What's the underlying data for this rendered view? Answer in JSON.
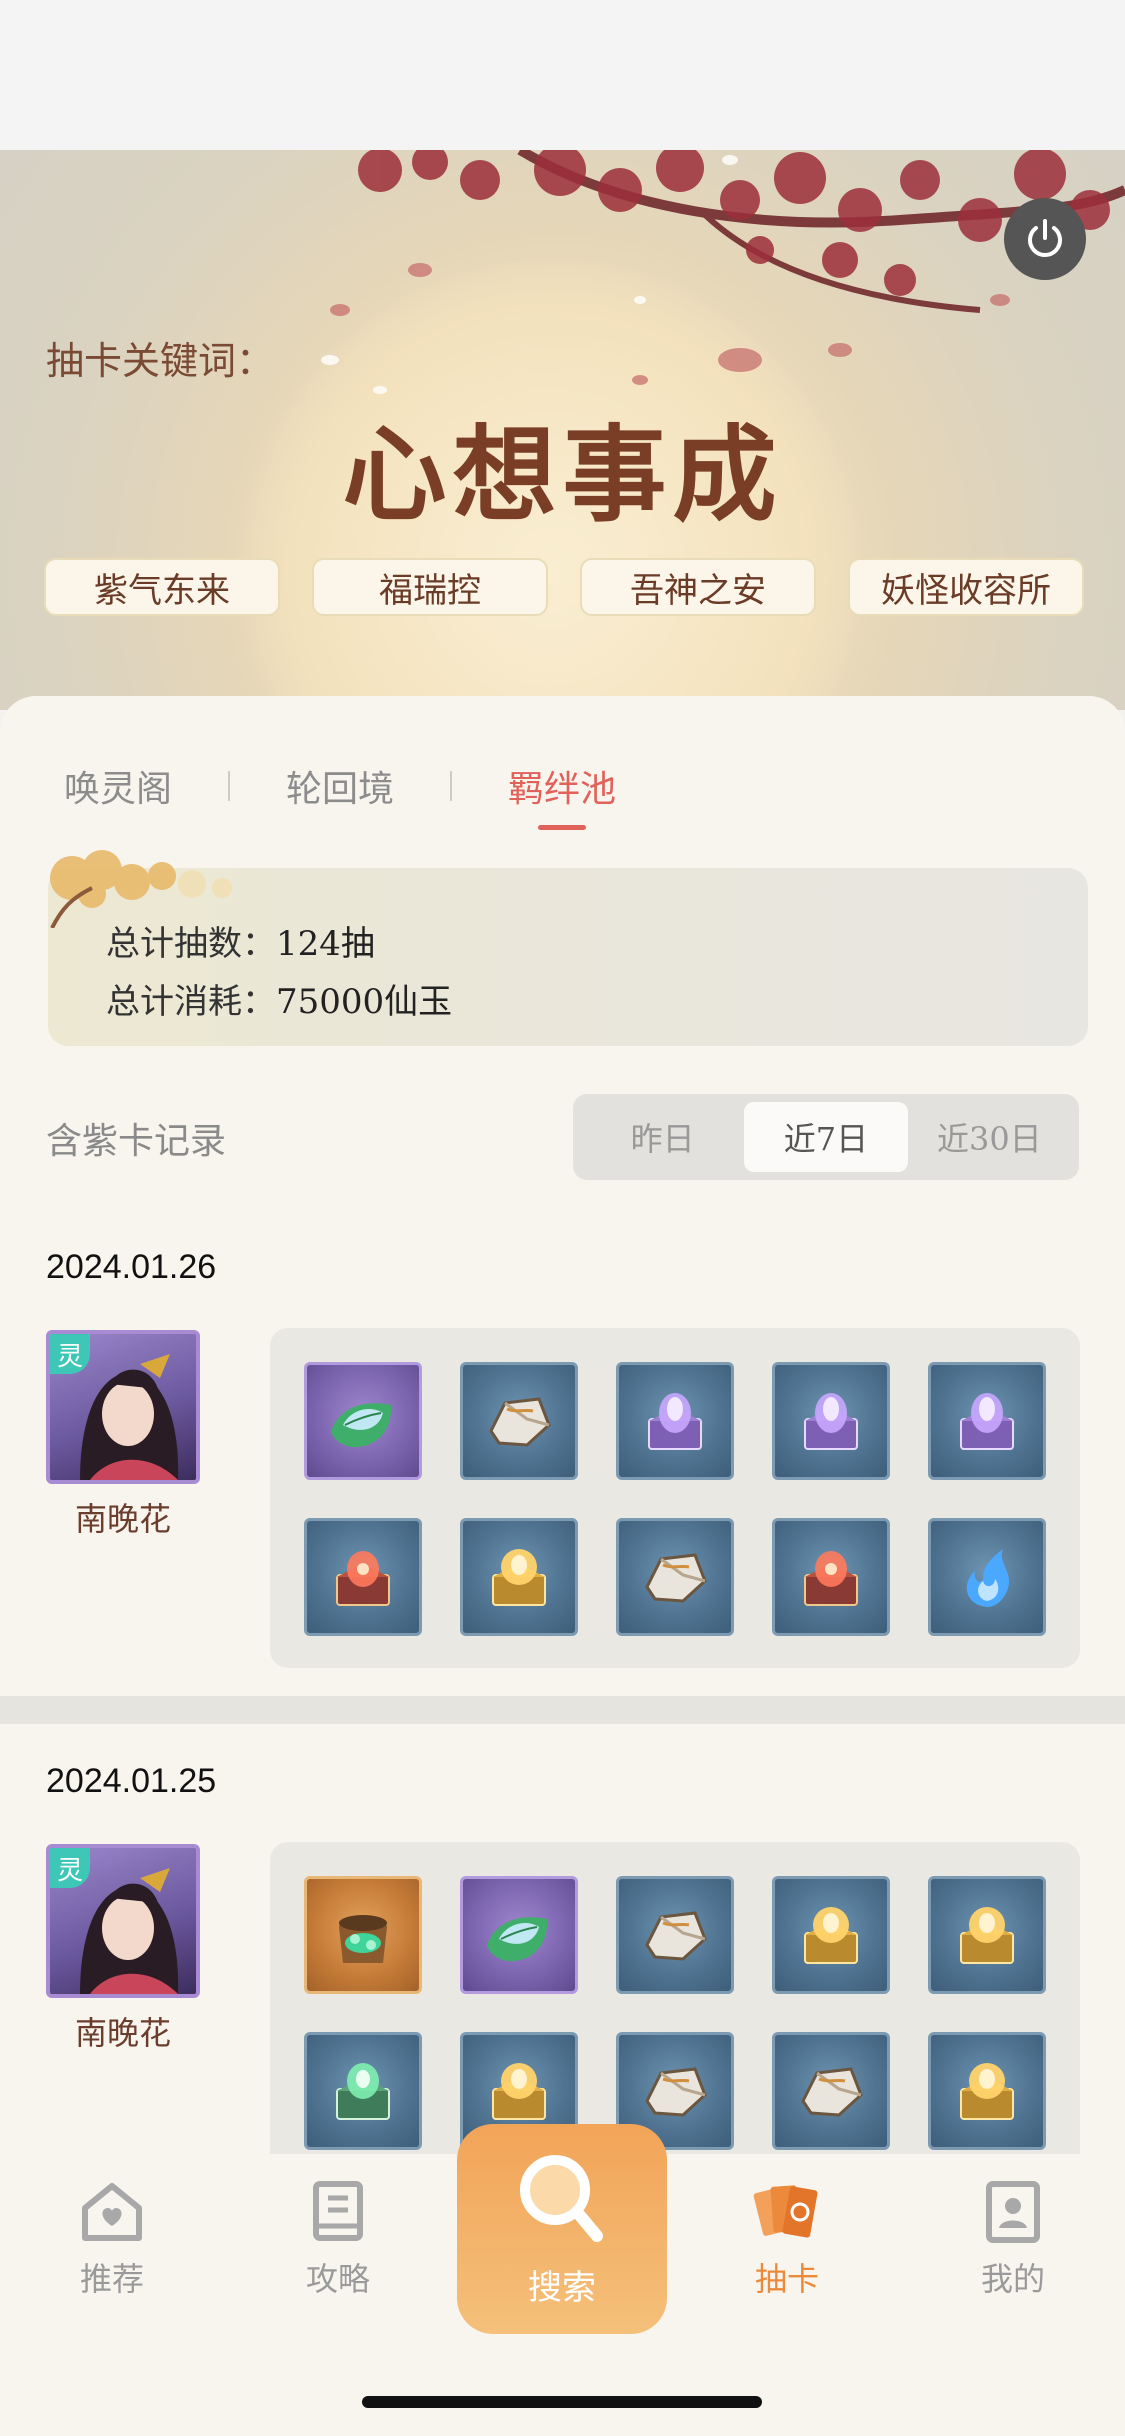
{
  "header": {
    "keyword_label": "抽卡关键词：",
    "keyword_title": "心想事成",
    "tags": [
      "紫气东来",
      "福瑞控",
      "吾神之安",
      "妖怪收容所"
    ]
  },
  "tabs": [
    {
      "label": "唤灵阁",
      "active": false
    },
    {
      "label": "轮回境",
      "active": false
    },
    {
      "label": "羁绊池",
      "active": true
    }
  ],
  "summary": {
    "total_draws_label": "总计抽数：",
    "total_draws_value": "124抽",
    "total_cost_label": "总计消耗：",
    "total_cost_value": "75000仙玉"
  },
  "records": {
    "title": "含紫卡记录",
    "ranges": [
      "昨日",
      "近7日",
      "近30日"
    ],
    "selected_range": "近7日"
  },
  "days": [
    {
      "date": "2024.01.26",
      "character": {
        "name": "南晚花",
        "badge": "灵"
      },
      "items": [
        {
          "frame": "purple",
          "icon": "leaf-gem-icon"
        },
        {
          "frame": "blue",
          "icon": "stone-icon"
        },
        {
          "frame": "blue",
          "icon": "purple-chest-icon"
        },
        {
          "frame": "blue",
          "icon": "purple-chest-icon"
        },
        {
          "frame": "blue",
          "icon": "purple-chest-icon"
        },
        {
          "frame": "blue",
          "icon": "red-chest-icon"
        },
        {
          "frame": "blue",
          "icon": "gold-chest-icon"
        },
        {
          "frame": "blue",
          "icon": "stone-icon"
        },
        {
          "frame": "blue",
          "icon": "red-chest-icon"
        },
        {
          "frame": "blue",
          "icon": "blue-flame-icon"
        }
      ]
    },
    {
      "date": "2024.01.25",
      "character": {
        "name": "南晚花",
        "badge": "灵"
      },
      "items": [
        {
          "frame": "orange",
          "icon": "treasure-bag-icon"
        },
        {
          "frame": "purple",
          "icon": "leaf-gem-icon"
        },
        {
          "frame": "blue",
          "icon": "stone-icon"
        },
        {
          "frame": "blue",
          "icon": "gold-chest-icon"
        },
        {
          "frame": "blue",
          "icon": "gold-chest-icon"
        },
        {
          "frame": "blue",
          "icon": "green-chest-icon"
        },
        {
          "frame": "blue",
          "icon": "gold-chest-icon"
        },
        {
          "frame": "blue",
          "icon": "stone-icon"
        },
        {
          "frame": "blue",
          "icon": "stone-icon"
        },
        {
          "frame": "blue",
          "icon": "gold-chest-icon"
        }
      ]
    }
  ],
  "nav": [
    {
      "label": "推荐",
      "icon": "home-heart-icon",
      "active": false
    },
    {
      "label": "攻略",
      "icon": "book-icon",
      "active": false
    },
    {
      "label": "搜索",
      "icon": "search-icon",
      "active": false
    },
    {
      "label": "抽卡",
      "icon": "cards-icon",
      "active": true
    },
    {
      "label": "我的",
      "icon": "profile-icon",
      "active": false
    }
  ],
  "colors": {
    "accent_red": "#e0625a",
    "accent_orange": "#ea8a3a",
    "title_brown": "#7a3e26"
  }
}
